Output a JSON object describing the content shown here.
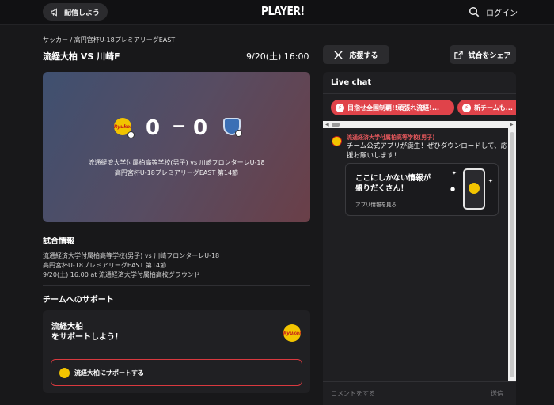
{
  "header": {
    "broadcast_label": "配信しよう",
    "logo": "PLAYER!",
    "login_label": "ログイン"
  },
  "match": {
    "breadcrumb": "サッカー / 高円宮杯U-18プレミアリーグEAST",
    "title": "流経大柏 VS 川崎F",
    "datetime": "9/20(土) 16:00",
    "home_score": "0",
    "score_separator": "−",
    "away_score": "0",
    "home_logo_text": "Ryukei",
    "card_teams": "流通経済大学付属柏高等学校(男子) vs 川崎フロンターレU-18",
    "card_competition": "高円宮杯U-18プレミアリーグEAST 第14節"
  },
  "match_info": {
    "heading": "試合情報",
    "line1": "流通経済大学付属柏高等学校(男子) vs 川崎フロンターレU-18",
    "line2": "高円宮杯U-18プレミアリーグEAST 第14節",
    "line3": "9/20(土) 16:00 at 流通経済大学付属柏高校グラウンド"
  },
  "support": {
    "heading": "チームへのサポート",
    "card_line1": "流経大柏",
    "card_line2": "をサポートしよう！",
    "button_label": "流経大柏にサポートする"
  },
  "actions": {
    "cheer_label": "応援する",
    "share_label": "試合をシェア"
  },
  "chat": {
    "title": "Live chat",
    "pills": [
      {
        "label": "目指せ全国制覇!!頑張れ流経!..."
      },
      {
        "label": "新チームも..."
      }
    ],
    "message": {
      "author": "流通経済大学付属柏高等学校(男子)",
      "text": "チーム公式アプリが誕生！ぜひダウンロードして、応援お願いします！"
    },
    "promo": {
      "title_line1": "ここにしかない情報が",
      "title_line2": "盛りだくさん！",
      "subtitle": "アプリ情報を見る"
    },
    "input_placeholder": "コメントをする",
    "send_label": "送信"
  },
  "colors": {
    "accent": "#e0434a",
    "background": "#18181a",
    "panel": "#1f1f22",
    "team_yellow": "#f2c400"
  }
}
